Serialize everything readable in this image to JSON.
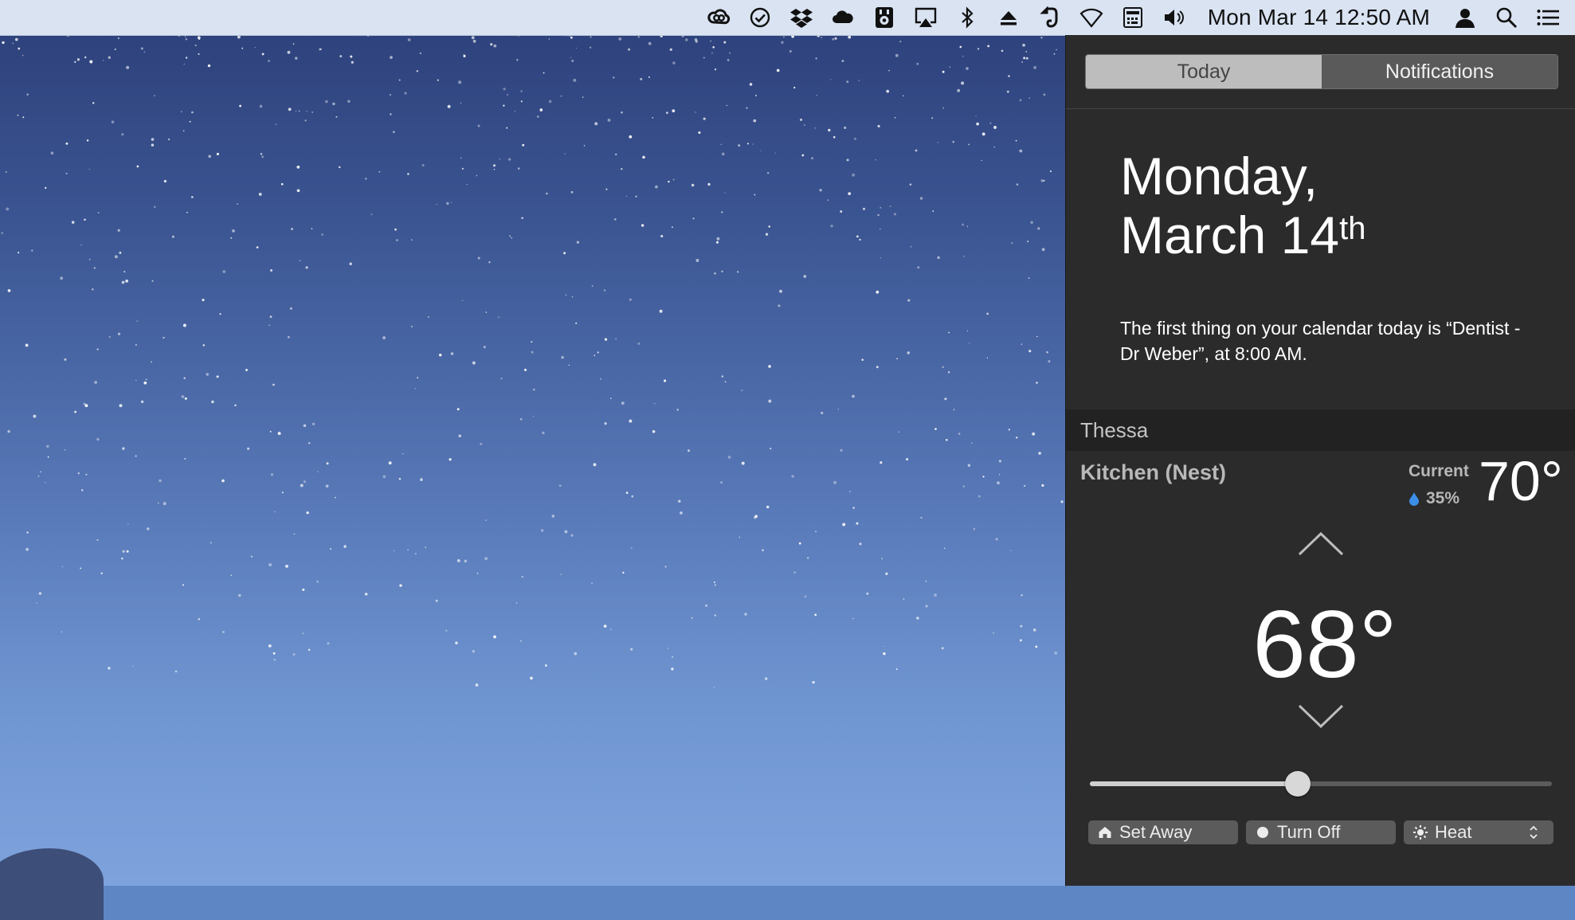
{
  "menubar": {
    "icons": [
      "creative-cloud-icon",
      "todo-check-icon",
      "dropbox-icon",
      "cloud-icon",
      "speaker-app-icon",
      "airplay-icon",
      "bluetooth-icon",
      "eject-icon",
      "evernote-icon",
      "wifi-icon",
      "keyboard-icon",
      "volume-icon"
    ],
    "clock": "Mon Mar 14  12:50 AM",
    "right_icons": [
      "user-icon",
      "spotlight-search-icon",
      "notification-center-icon"
    ]
  },
  "notification_center": {
    "tabs": [
      {
        "label": "Today",
        "active": true
      },
      {
        "label": "Notifications",
        "active": false
      }
    ],
    "today": {
      "weekday": "Monday,",
      "date_main": "March 14",
      "date_suffix": "th",
      "calendar_summary": "The first thing on your calendar today is “Dentist - Dr Weber”, at 8:00 AM."
    },
    "thermostat_widget": {
      "title": "Thessa",
      "device_name": "Kitchen (Nest)",
      "current_label": "Current",
      "current_temp": "70°",
      "humidity": "35%",
      "target_temp": "68°",
      "slider_value": 0.45,
      "buttons": {
        "set_away": "Set Away",
        "turn_off": "Turn Off",
        "mode": "Heat"
      }
    }
  },
  "colors": {
    "panel_bg": "#2b2b2b",
    "menubar_bg": "#d9e3f2",
    "humidity_drop": "#3b8fe8"
  }
}
